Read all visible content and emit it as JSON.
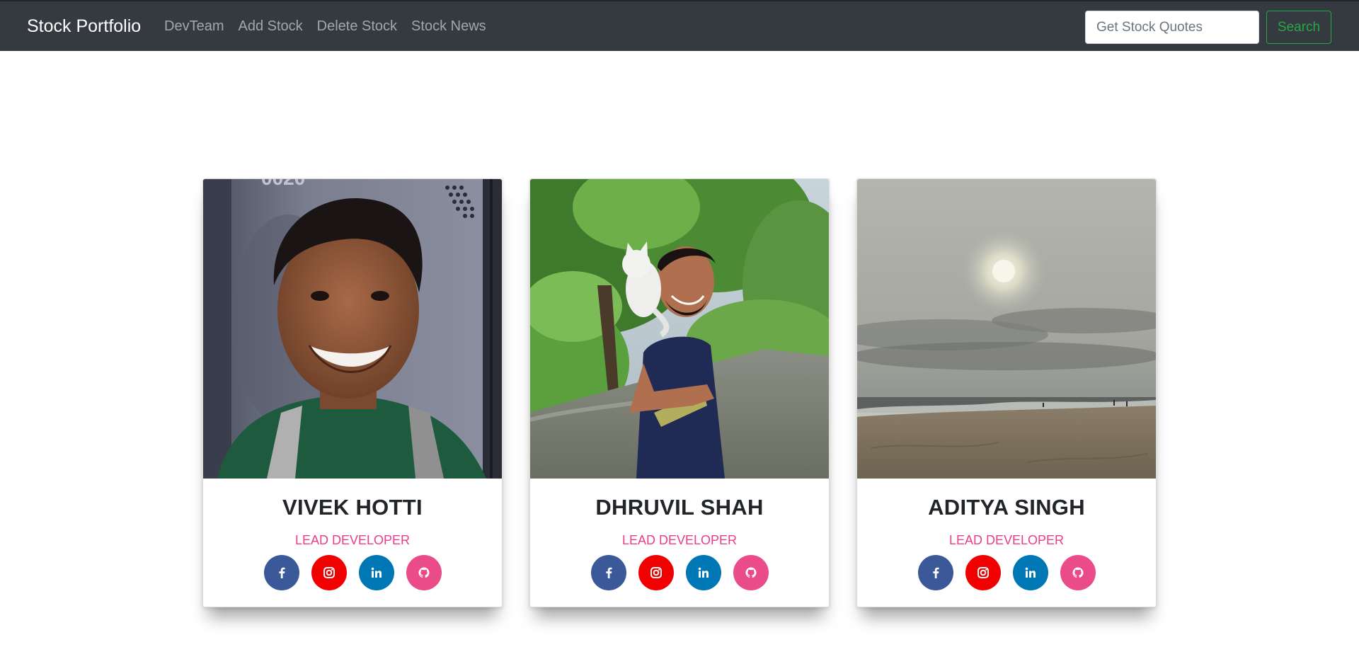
{
  "navbar": {
    "brand": "Stock Portfolio",
    "links": [
      {
        "label": "DevTeam"
      },
      {
        "label": "Add Stock"
      },
      {
        "label": "Delete Stock"
      },
      {
        "label": "Stock News"
      }
    ],
    "search": {
      "placeholder": "Get Stock Quotes",
      "value": ""
    },
    "search_button": "Search"
  },
  "team": [
    {
      "name": "VIVEK HOTTI",
      "role": "LEAD DEVELOPER",
      "photo": "portrait-photo"
    },
    {
      "name": "DHRUVIL SHAH",
      "role": "LEAD DEVELOPER",
      "photo": "outdoor-photo-with-cat"
    },
    {
      "name": "ADITYA SINGH",
      "role": "LEAD DEVELOPER",
      "photo": "beach-photo"
    }
  ],
  "social_icons": [
    {
      "icon": "facebook-icon",
      "color": "#3b5998"
    },
    {
      "icon": "instagram-icon",
      "color": "#f00000"
    },
    {
      "icon": "linkedin-icon",
      "color": "#0077b5"
    },
    {
      "icon": "github-icon",
      "color": "#ea4c89"
    }
  ]
}
